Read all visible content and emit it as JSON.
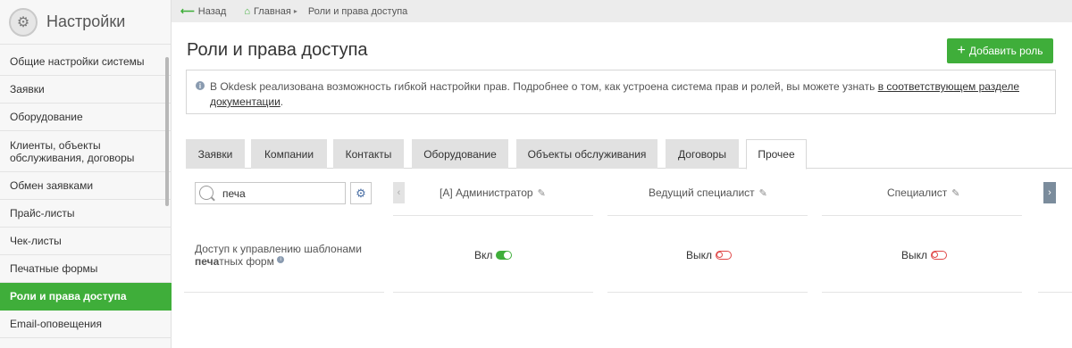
{
  "sidebar": {
    "title": "Настройки",
    "items": [
      {
        "label": "Общие настройки системы"
      },
      {
        "label": "Заявки"
      },
      {
        "label": "Оборудование"
      },
      {
        "label": "Клиенты, объекты обслуживания, договоры"
      },
      {
        "label": "Обмен заявками"
      },
      {
        "label": "Прайс-листы"
      },
      {
        "label": "Чек-листы"
      },
      {
        "label": "Печатные формы"
      },
      {
        "label": "Роли и права доступа"
      },
      {
        "label": "Email-оповещения"
      }
    ]
  },
  "breadcrumb": {
    "back": "Назад",
    "home": "Главная",
    "current": "Роли и права доступа"
  },
  "header": {
    "title": "Роли и права доступа",
    "add_button": "Добавить роль"
  },
  "info": {
    "text": "В Okdesk реализована возможность гибкой настройки прав. Подробнее о том, как устроена система прав и ролей, вы можете узнать ",
    "link_line1": "в соответствующем разделе",
    "link_line2": "документации",
    "end": "."
  },
  "tabs": [
    {
      "label": "Заявки"
    },
    {
      "label": "Компании"
    },
    {
      "label": "Контакты"
    },
    {
      "label": "Оборудование"
    },
    {
      "label": "Объекты обслуживания"
    },
    {
      "label": "Договоры"
    },
    {
      "label": "Прочее"
    }
  ],
  "search": {
    "value": "печа"
  },
  "roles": [
    {
      "name": "[A] Администратор"
    },
    {
      "name": "Ведущий специалист"
    },
    {
      "name": "Специалист"
    }
  ],
  "permission": {
    "label_prefix": "Доступ к управлению шаблонами ",
    "label_bold": "печа",
    "label_suffix": "тных форм",
    "states": [
      "Вкл",
      "Выкл",
      "Выкл"
    ]
  },
  "colors": {
    "accent": "#3fae3a",
    "off": "#e04848"
  }
}
